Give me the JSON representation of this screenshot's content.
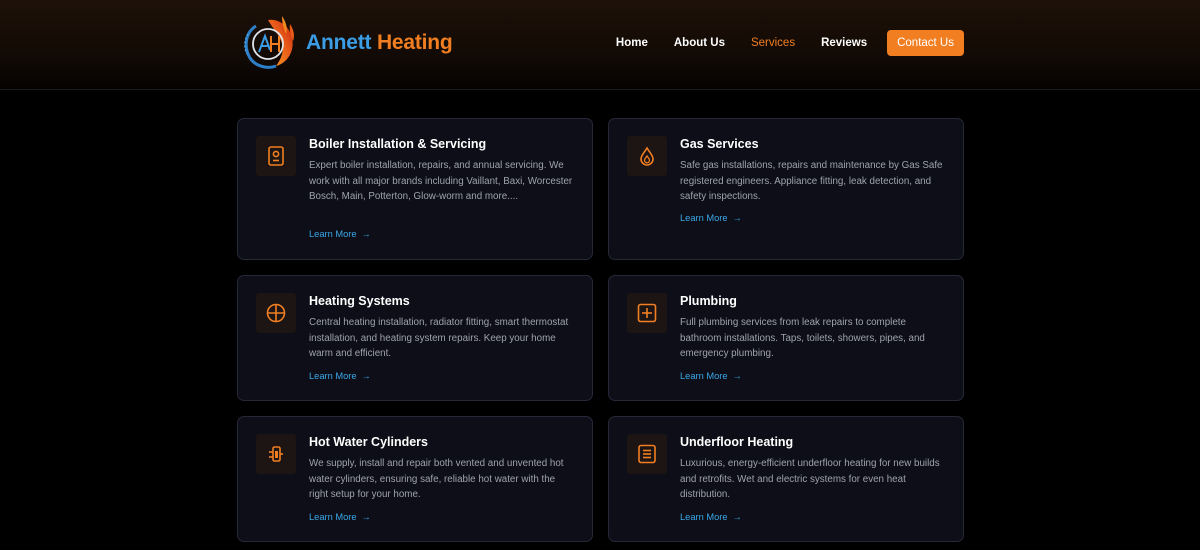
{
  "brand": {
    "name_part1": "Annett",
    "name_part2": "Heating",
    "logo_icon": "flame-ah-monogram-icon",
    "colors": {
      "blue": "#3b9de6",
      "orange": "#f17f22"
    }
  },
  "nav": {
    "items": [
      {
        "label": "Home",
        "active": false
      },
      {
        "label": "About Us",
        "active": false
      },
      {
        "label": "Services",
        "active": true
      },
      {
        "label": "Reviews",
        "active": false
      }
    ],
    "contact_label": "Contact Us"
  },
  "services": [
    {
      "title": "Boiler Installation & Servicing",
      "description": "Expert boiler installation, repairs, and annual servicing. We work with all major brands including Vaillant, Baxi, Worcester Bosch, Main, Potterton, Glow-worm and more....",
      "link": "Learn More",
      "icon": "boiler-icon"
    },
    {
      "title": "Gas Services",
      "description": "Safe gas installations, repairs and maintenance by Gas Safe registered engineers. Appliance fitting, leak detection, and safety inspections.",
      "link": "Learn More",
      "icon": "flame-drop-icon"
    },
    {
      "title": "Heating Systems",
      "description": "Central heating installation, radiator fitting, smart thermostat installation, and heating system repairs. Keep your home warm and efficient.",
      "link": "Learn More",
      "icon": "crosshair-circle-icon"
    },
    {
      "title": "Plumbing",
      "description": "Full plumbing services from leak repairs to complete bathroom installations. Taps, toilets, showers, pipes, and emergency plumbing.",
      "link": "Learn More",
      "icon": "plus-square-icon"
    },
    {
      "title": "Hot Water Cylinders",
      "description": "We supply, install and repair both vented and unvented hot water cylinders, ensuring safe, reliable hot water with the right setup for your home.",
      "link": "Learn More",
      "icon": "water-cylinder-icon"
    },
    {
      "title": "Underfloor Heating",
      "description": "Luxurious, energy-efficient underfloor heating for new builds and retrofits. Wet and electric systems for even heat distribution.",
      "link": "Learn More",
      "icon": "underfloor-lines-icon"
    }
  ],
  "arrow_glyph": "→",
  "accent_color": "#f17f22",
  "link_color": "#3aa8e8"
}
